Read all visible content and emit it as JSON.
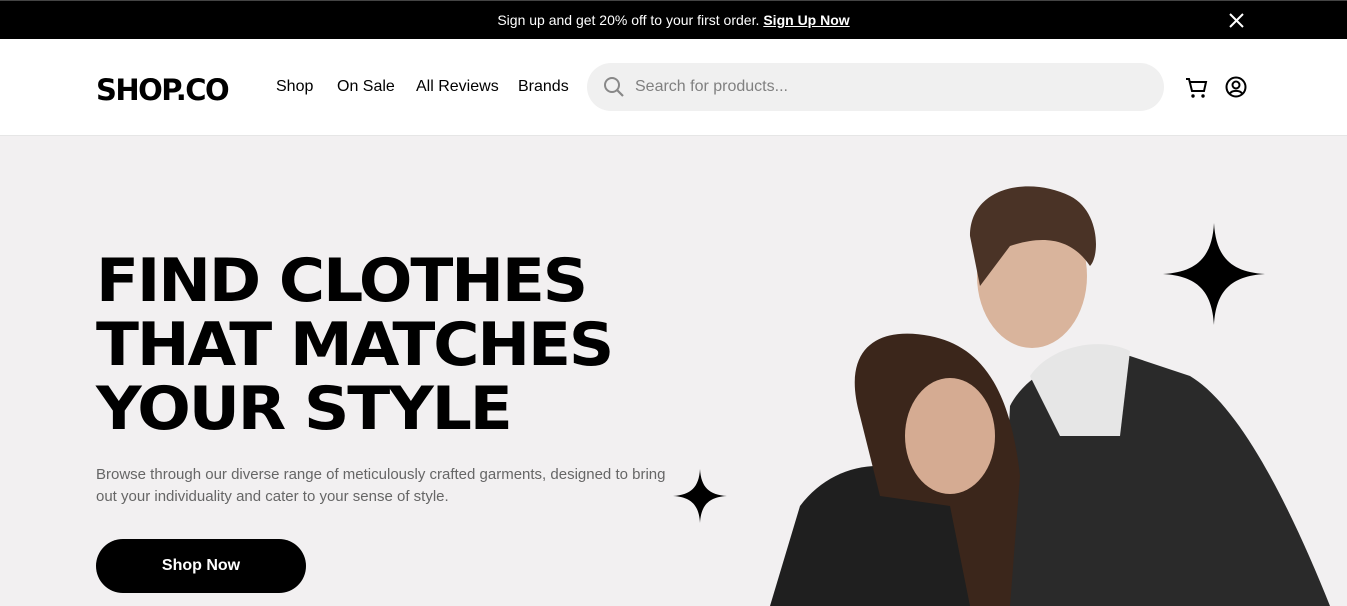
{
  "announcement": {
    "text": "Sign up and get 20% off to your first order.",
    "link": "Sign Up Now"
  },
  "header": {
    "logo": "SHOP.CO",
    "nav": [
      "Shop",
      "On Sale",
      "All Reviews",
      "Brands"
    ],
    "search_placeholder": "Search for products..."
  },
  "hero": {
    "title_lines": [
      "FIND CLOTHES",
      "THAT MATCHES",
      "YOUR STYLE"
    ],
    "description": "Browse through our diverse range of meticulously crafted garments, designed to bring out your individuality and cater to your sense of style.",
    "cta": "Shop Now"
  },
  "colors": {
    "hero_bg": "#F2F0F1",
    "accent": "#000000"
  }
}
